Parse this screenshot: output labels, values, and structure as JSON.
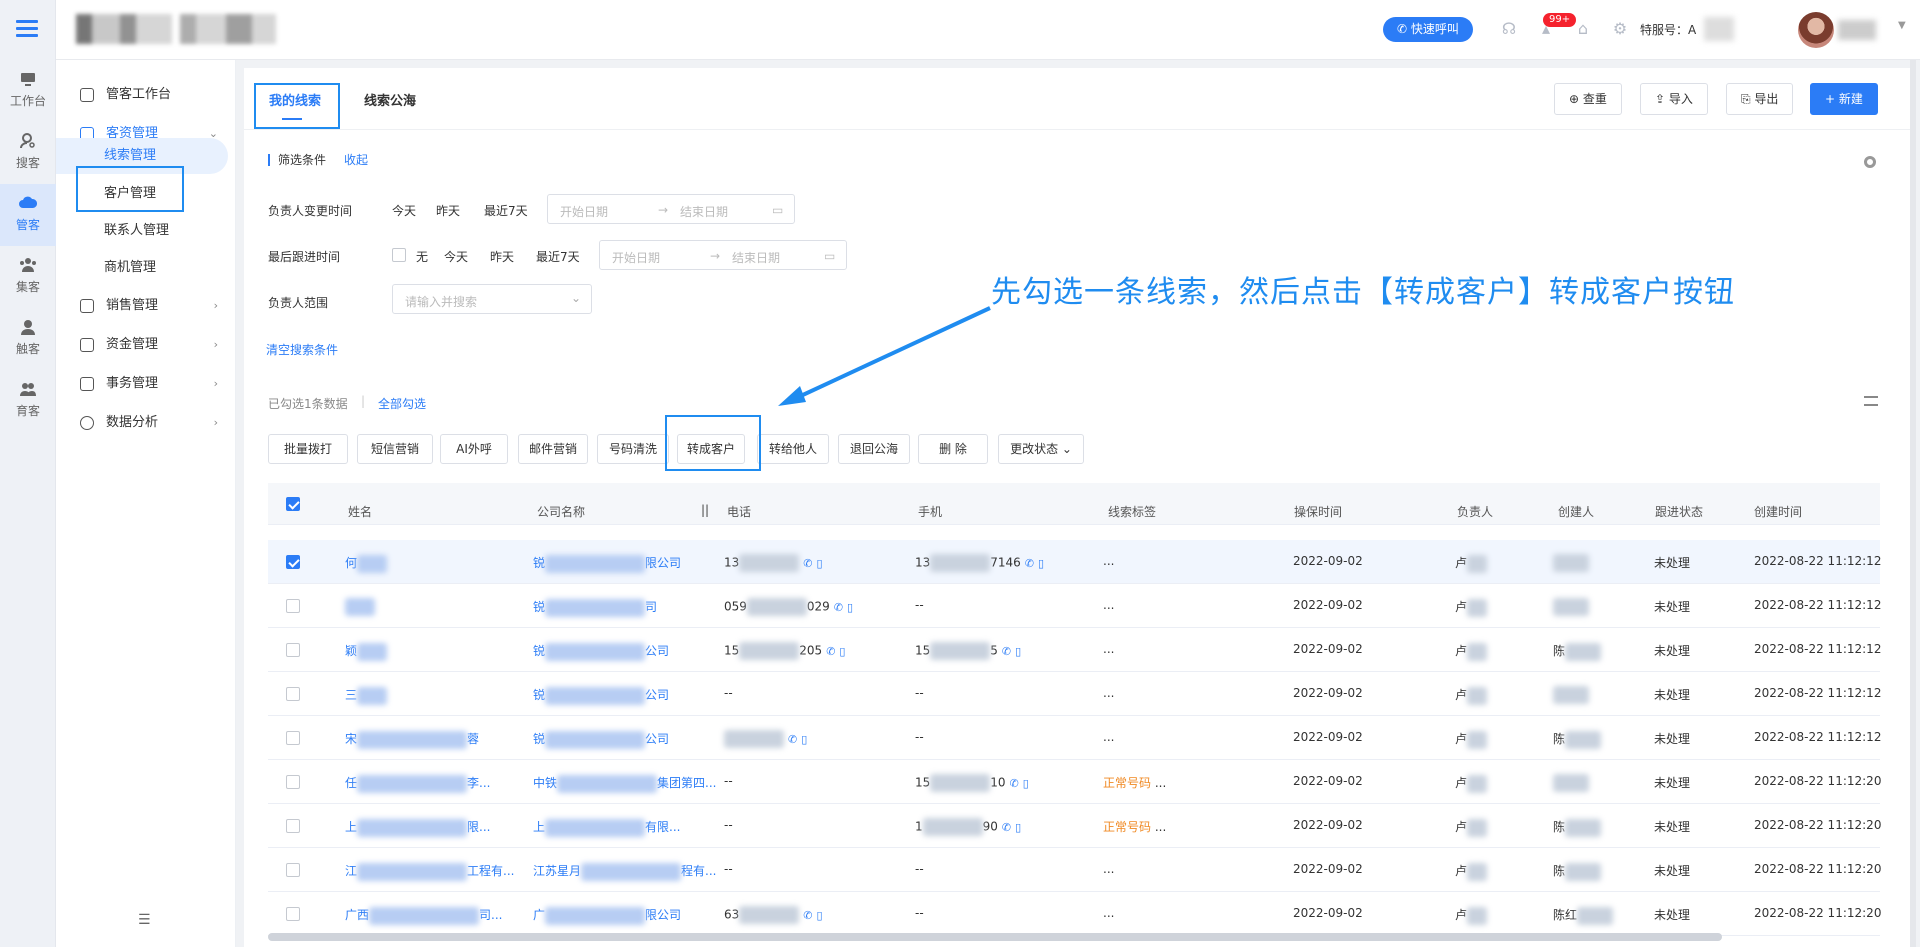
{
  "topbar": {
    "quick_call": "快速呼叫",
    "badge": "99+",
    "service_no_label": "特服号：",
    "service_prefix": "A"
  },
  "rail": [
    {
      "label": "工作台"
    },
    {
      "label": "搜客"
    },
    {
      "label": "管客"
    },
    {
      "label": "集客"
    },
    {
      "label": "触客"
    },
    {
      "label": "育客"
    }
  ],
  "sidemenu": {
    "workbench": "管客工作台",
    "customer_mgmt": "客资管理",
    "sub": [
      "线索管理",
      "客户管理",
      "联系人管理",
      "商机管理"
    ],
    "sales": "销售管理",
    "funds": "资金管理",
    "affairs": "事务管理",
    "analytics": "数据分析"
  },
  "tabs": [
    "我的线索",
    "线索公海"
  ],
  "toolbar": {
    "dedupe": "查重",
    "import": "导入",
    "export": "导出",
    "create": "+ 新建"
  },
  "filter": {
    "title": "筛选条件",
    "collapse": "收起",
    "owner_change_label": "负责人变更时间",
    "owner_change_opts": [
      "今天",
      "昨天",
      "最近7天"
    ],
    "last_follow_label": "最后跟进时间",
    "last_follow_opts": [
      "无",
      "今天",
      "昨天",
      "最近7天"
    ],
    "start_ph": "开始日期",
    "end_ph": "结束日期",
    "owner_scope_label": "负责人范围",
    "owner_scope_ph": "请输入并搜索",
    "clear": "清空搜索条件"
  },
  "selection": {
    "info": "已勾选1条数据",
    "select_all": "全部勾选"
  },
  "actions": [
    "批量拨打",
    "短信营销",
    "AI外呼",
    "邮件营销",
    "号码清洗",
    "转成客户",
    "转给他人",
    "退回公海",
    "删 除",
    "更改状态 ⌄"
  ],
  "columns": [
    "姓名",
    "公司名称",
    "电话",
    "手机",
    "线索标签",
    "操保时间",
    "负责人",
    "创建人",
    "跟进状态",
    "创建时间"
  ],
  "rows": [
    {
      "name": "何",
      "company_a": "锐",
      "company_b": "限公司",
      "phone_a": "13",
      "phone_b": "",
      "mobile_a": "13",
      "mobile_b": "7146",
      "tag": "...",
      "date": "2022-09-02",
      "owner": "卢",
      "creator": "",
      "status": "未处理",
      "created": "2022-08-22 11:12:12",
      "checked": true
    },
    {
      "name": "",
      "company_a": "锐",
      "company_b": "司",
      "phone_a": "059",
      "phone_b": "029",
      "mobile_a": "--",
      "mobile_b": "",
      "tag": "...",
      "date": "2022-09-02",
      "owner": "卢",
      "creator": "",
      "status": "未处理",
      "created": "2022-08-22 11:12:12",
      "checked": false
    },
    {
      "name": "颖",
      "company_a": "锐",
      "company_b": "公司",
      "phone_a": "15",
      "phone_b": "205",
      "mobile_a": "15",
      "mobile_b": "5",
      "tag": "...",
      "date": "2022-09-02",
      "owner": "卢",
      "creator": "陈",
      "status": "未处理",
      "created": "2022-08-22 11:12:12",
      "checked": false
    },
    {
      "name": "三",
      "company_a": "锐",
      "company_b": "公司",
      "phone_a": "--",
      "phone_b": "",
      "mobile_a": "--",
      "mobile_b": "",
      "tag": "...",
      "date": "2022-09-02",
      "owner": "卢",
      "creator": "",
      "status": "未处理",
      "created": "2022-08-22 11:12:12",
      "checked": false
    },
    {
      "name": "宋",
      "name_b": "蓉",
      "company_a": "锐",
      "company_b": "公司",
      "phone_a": "",
      "phone_b": "",
      "mobile_a": "--",
      "mobile_b": "",
      "tag": "...",
      "date": "2022-09-02",
      "owner": "卢",
      "creator": "陈",
      "status": "未处理",
      "created": "2022-08-22 11:12:12",
      "checked": false
    },
    {
      "name": "任",
      "name_b": "李...",
      "company_a": "中铁",
      "company_b": "集团第四...",
      "phone_a": "--",
      "phone_b": "",
      "mobile_a": "15",
      "mobile_b": "10",
      "tag": "正常号码",
      "date": "2022-09-02",
      "owner": "卢",
      "creator": "",
      "status": "未处理",
      "created": "2022-08-22 11:12:20",
      "checked": false
    },
    {
      "name": "上",
      "name_b": "限...",
      "company_a": "上",
      "company_b": "有限...",
      "phone_a": "--",
      "phone_b": "",
      "mobile_a": "1",
      "mobile_b": "90",
      "tag": "正常号码",
      "date": "2022-09-02",
      "owner": "卢",
      "creator": "陈",
      "status": "未处理",
      "created": "2022-08-22 11:12:20",
      "checked": false
    },
    {
      "name": "江",
      "name_b": "工程有...",
      "company_a": "江苏星月",
      "company_b": "程有...",
      "phone_a": "--",
      "phone_b": "",
      "mobile_a": "--",
      "mobile_b": "",
      "tag": "...",
      "date": "2022-09-02",
      "owner": "卢",
      "creator": "陈",
      "status": "未处理",
      "created": "2022-08-22 11:12:20",
      "checked": false
    },
    {
      "name": "广西",
      "name_b": "司...",
      "company_a": "广",
      "company_b": "限公司",
      "phone_a": "63",
      "phone_b": "",
      "mobile_a": "--",
      "mobile_b": "",
      "tag": "...",
      "date": "2022-09-02",
      "owner": "卢",
      "creator": "陈红",
      "status": "未处理",
      "created": "2022-08-22 11:12:20",
      "checked": false
    }
  ],
  "annotation": "先勾选一条线索，然后点击【转成客户】转成客户按钮"
}
